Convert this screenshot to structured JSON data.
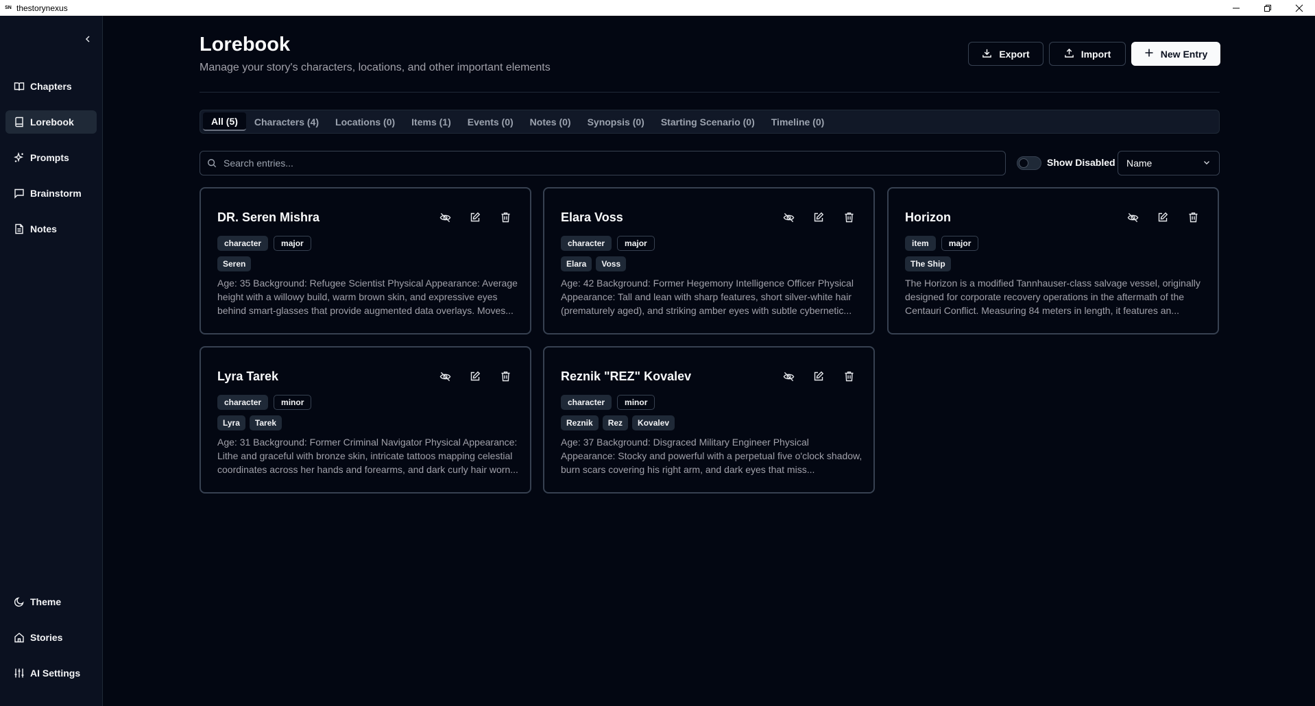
{
  "window": {
    "icon_text": "SN",
    "title": "thestorynexus"
  },
  "sidebar": {
    "items": [
      {
        "label": "Chapters",
        "icon": "book-open-icon"
      },
      {
        "label": "Lorebook",
        "icon": "book-icon",
        "active": true
      },
      {
        "label": "Prompts",
        "icon": "sparkles-icon"
      },
      {
        "label": "Brainstorm",
        "icon": "message-square-icon"
      },
      {
        "label": "Notes",
        "icon": "file-text-icon"
      }
    ],
    "bottom_items": [
      {
        "label": "Theme",
        "icon": "moon-icon"
      },
      {
        "label": "Stories",
        "icon": "home-icon"
      },
      {
        "label": "AI Settings",
        "icon": "sliders-icon"
      }
    ]
  },
  "header": {
    "title": "Lorebook",
    "subtitle": "Manage your story's characters, locations, and other important elements",
    "export_label": "Export",
    "import_label": "Import",
    "new_entry_label": "New Entry"
  },
  "tabs": [
    "All (5)",
    "Characters (4)",
    "Locations (0)",
    "Items (1)",
    "Events (0)",
    "Notes (0)",
    "Synopsis (0)",
    "Starting Scenario (0)",
    "Timeline (0)"
  ],
  "active_tab": 0,
  "search": {
    "placeholder": "Search entries..."
  },
  "filters": {
    "show_disabled_label": "Show Disabled",
    "show_disabled": false,
    "sort_value": "Name"
  },
  "entries": [
    {
      "name": "DR. Seren Mishra",
      "type": "character",
      "importance": "major",
      "aliases": [
        "Seren"
      ],
      "description": "Age: 35 Background: Refugee Scientist Physical Appearance: Average height with a willowy build, warm brown skin, and expressive eyes behind smart-glasses that provide augmented data overlays. Moves..."
    },
    {
      "name": "Elara Voss",
      "type": "character",
      "importance": "major",
      "aliases": [
        "Elara",
        "Voss"
      ],
      "description": "Age: 42 Background: Former Hegemony Intelligence Officer Physical Appearance: Tall and lean with sharp features, short silver-white hair (prematurely aged), and striking amber eyes with subtle cybernetic..."
    },
    {
      "name": "Horizon",
      "type": "item",
      "importance": "major",
      "aliases": [
        "The Ship"
      ],
      "description": "The Horizon is a modified Tannhauser-class salvage vessel, originally designed for corporate recovery operations in the aftermath of the Centauri Conflict. Measuring 84 meters in length, it features an..."
    },
    {
      "name": "Lyra Tarek",
      "type": "character",
      "importance": "minor",
      "aliases": [
        "Lyra",
        "Tarek"
      ],
      "description": "Age: 31 Background: Former Criminal Navigator Physical Appearance: Lithe and graceful with bronze skin, intricate tattoos mapping celestial coordinates across her hands and forearms, and dark curly hair worn..."
    },
    {
      "name": "Reznik \"REZ\" Kovalev",
      "type": "character",
      "importance": "minor",
      "aliases": [
        "Reznik",
        "Rez",
        "Kovalev"
      ],
      "description": "Age: 37 Background: Disgraced Military Engineer Physical Appearance: Stocky and powerful with a perpetual five o'clock shadow, burn scars covering his right arm, and dark eyes that miss..."
    }
  ]
}
